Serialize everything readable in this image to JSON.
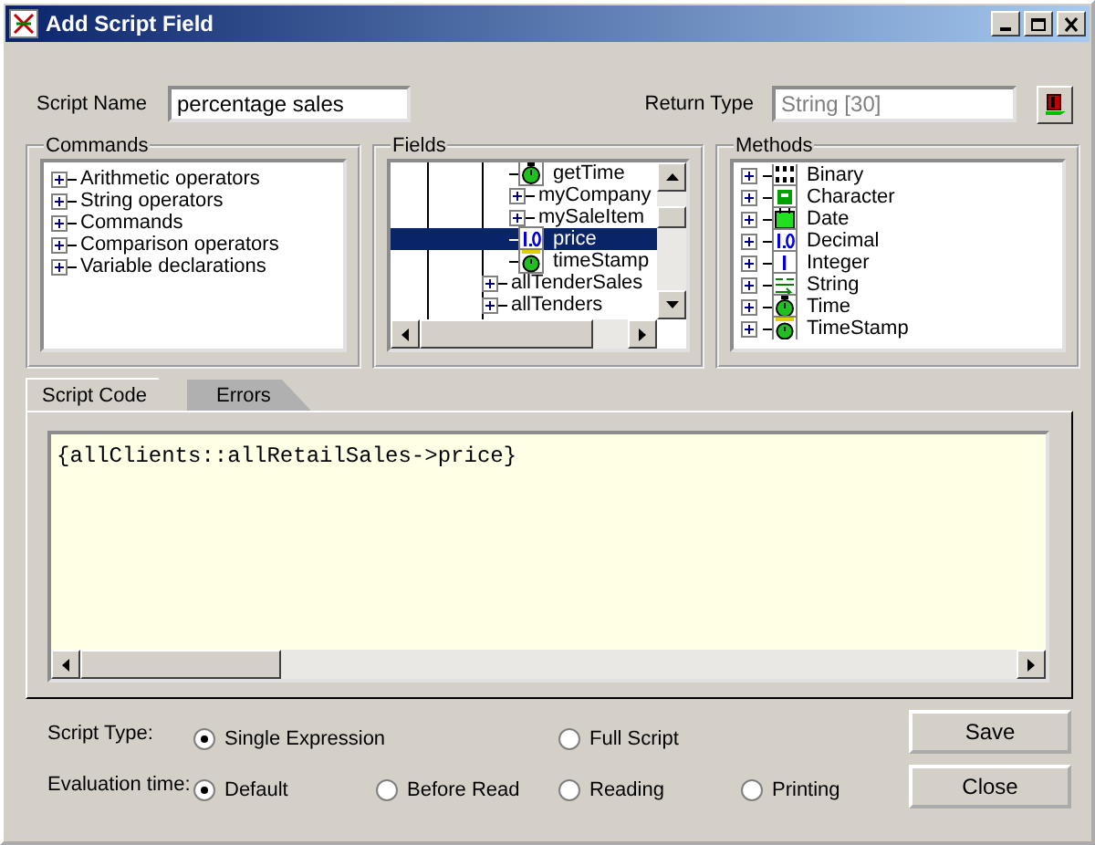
{
  "window": {
    "title": "Add Script Field"
  },
  "script_name": {
    "label": "Script Name",
    "value": "percentage sales"
  },
  "return_type": {
    "label": "Return Type",
    "value": "String [30]",
    "disabled": true
  },
  "commands": {
    "title": "Commands",
    "items": [
      {
        "label": "Arithmetic operators",
        "kind": "group",
        "selected": false
      },
      {
        "label": "String operators",
        "kind": "group",
        "selected": false
      },
      {
        "label": "Commands",
        "kind": "group",
        "selected": false
      },
      {
        "label": "Comparison operators",
        "kind": "group",
        "selected": false
      },
      {
        "label": "Variable declarations",
        "kind": "group",
        "selected": false
      }
    ]
  },
  "fields": {
    "title": "Fields",
    "items": [
      {
        "children": [
          {
            "label": "getTime",
            "kind": "time",
            "selected": false
          },
          {
            "label": "myCompany",
            "kind": "group",
            "selected": false
          },
          {
            "label": "mySaleItem",
            "kind": "group",
            "selected": false
          },
          {
            "label": "price",
            "kind": "decimal",
            "selected": true
          },
          {
            "label": "timeStamp",
            "kind": "timestamp",
            "selected": false
          }
        ]
      },
      {
        "label": "allTenderSales",
        "kind": "group",
        "selected": false
      },
      {
        "label": "allTenders",
        "kind": "group",
        "selected": false
      }
    ]
  },
  "methods": {
    "title": "Methods",
    "items": [
      {
        "label": "Binary",
        "kind": "binary",
        "selected": false
      },
      {
        "label": "Character",
        "kind": "character",
        "selected": false
      },
      {
        "label": "Date",
        "kind": "date",
        "selected": false
      },
      {
        "label": "Decimal",
        "kind": "decimal",
        "selected": false
      },
      {
        "label": "Integer",
        "kind": "integer",
        "selected": false
      },
      {
        "label": "String",
        "kind": "string",
        "selected": false
      },
      {
        "label": "Time",
        "kind": "time",
        "selected": false
      },
      {
        "label": "TimeStamp",
        "kind": "timestamp",
        "selected": false
      }
    ]
  },
  "tabs": [
    {
      "label": "Script Code",
      "selected": true
    },
    {
      "label": "Errors",
      "selected": false
    }
  ],
  "script_code": "{allClients::allRetailSales->price}",
  "script_type": {
    "label": "Script Type:",
    "options": [
      {
        "label": "Single Expression",
        "selected": true
      },
      {
        "label": "Full Script",
        "selected": false
      }
    ]
  },
  "evaluation_time": {
    "label": "Evaluation time:",
    "options": [
      {
        "label": "Default",
        "selected": true
      },
      {
        "label": "Before Read",
        "selected": false
      },
      {
        "label": "Reading",
        "selected": false
      },
      {
        "label": "Printing",
        "selected": false
      }
    ]
  },
  "buttons": [
    {
      "label": "Save"
    },
    {
      "label": "Close"
    }
  ]
}
